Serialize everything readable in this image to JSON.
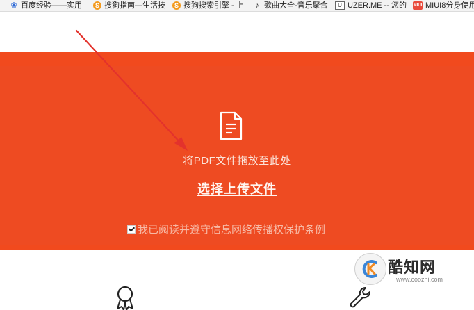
{
  "bookmarks": [
    {
      "label": "百度经验——实用",
      "icon": "paw-icon"
    },
    {
      "label": "搜狗指南—生活技",
      "icon": "sogou-icon"
    },
    {
      "label": "搜狗搜索引擎 - 上",
      "icon": "sogou-icon"
    },
    {
      "label": "歌曲大全-音乐聚合",
      "icon": "music-icon"
    },
    {
      "label": "UZER.ME -- 您的",
      "icon": "uzer-icon"
    },
    {
      "label": "MIUI8分身使用",
      "icon": "miui-icon"
    }
  ],
  "upload": {
    "drop_text": "将PDF文件拖放至此处",
    "select_label": "选择上传文件",
    "agree_label": "我已阅读并遵守信息网络传播权保护条例",
    "agree_checked": true,
    "accent_color": "#f14a1e"
  },
  "watermark": {
    "title": "酷知网",
    "url": "www.coozhi.com"
  },
  "features": [
    {
      "icon": "award-ribbon-icon"
    },
    {
      "icon": "wrench-icon"
    }
  ]
}
